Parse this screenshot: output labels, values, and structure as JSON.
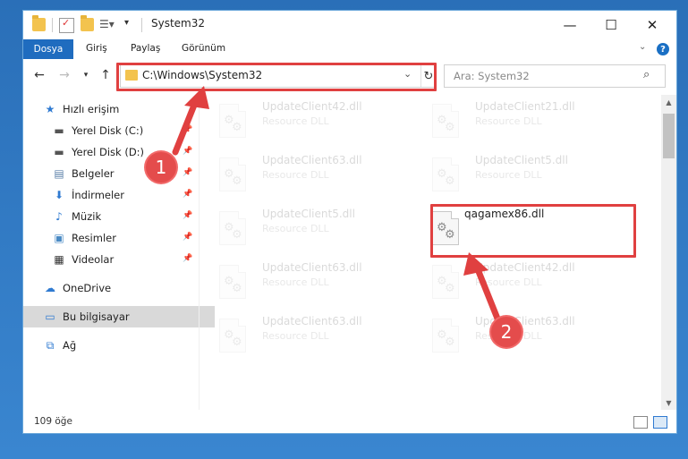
{
  "window": {
    "title": "System32",
    "controls": {
      "minimize": "—",
      "maximize": "☐",
      "close": "✕"
    }
  },
  "ribbon": {
    "tabs": [
      "Dosya",
      "Giriş",
      "Paylaş",
      "Görünüm"
    ],
    "help": "?"
  },
  "navigation": {
    "address": "C:\\Windows\\System32",
    "search_placeholder": "Ara: System32"
  },
  "sidebar": {
    "items": [
      {
        "label": "Hızlı erişim",
        "icon": "star-icon"
      },
      {
        "label": "Yerel Disk (C:)",
        "icon": "drive-icon",
        "pinned": true
      },
      {
        "label": "Yerel Disk (D:)",
        "icon": "drive-icon",
        "pinned": true
      },
      {
        "label": "Belgeler",
        "icon": "documents-icon",
        "pinned": true
      },
      {
        "label": "İndirmeler",
        "icon": "download-icon",
        "pinned": true
      },
      {
        "label": "Müzik",
        "icon": "music-icon",
        "pinned": true
      },
      {
        "label": "Resimler",
        "icon": "pictures-icon",
        "pinned": true
      },
      {
        "label": "Videolar",
        "icon": "videos-icon",
        "pinned": true
      },
      {
        "label": "OneDrive",
        "icon": "cloud-icon"
      },
      {
        "label": "Bu bilgisayar",
        "icon": "computer-icon",
        "selected": true
      },
      {
        "label": "Ağ",
        "icon": "network-icon"
      }
    ]
  },
  "files": [
    {
      "name": "UpdateClient42.dll",
      "type": "Resource DLL",
      "faded": true
    },
    {
      "name": "UpdateClient21.dll",
      "type": "Resource DLL",
      "faded": true
    },
    {
      "name": "UpdateClient63.dll",
      "type": "Resource DLL",
      "faded": true
    },
    {
      "name": "UpdateClient5.dll",
      "type": "Resource DLL",
      "faded": true
    },
    {
      "name": "UpdateClient5.dll",
      "type": "Resource DLL",
      "faded": true
    },
    {
      "name": "qagamex86.dll",
      "type": "",
      "faded": false
    },
    {
      "name": "UpdateClient63.dll",
      "type": "Resource DLL",
      "faded": true
    },
    {
      "name": "UpdateClient42.dll",
      "type": "Resource DLL",
      "faded": true
    },
    {
      "name": "UpdateClient63.dll",
      "type": "Resource DLL",
      "faded": true
    },
    {
      "name": "UpdateClient63.dll",
      "type": "Resource DLL",
      "faded": true
    }
  ],
  "status": {
    "count": "109 öğe"
  },
  "annotations": {
    "step1": "1",
    "step2": "2",
    "color": "#e04040"
  }
}
